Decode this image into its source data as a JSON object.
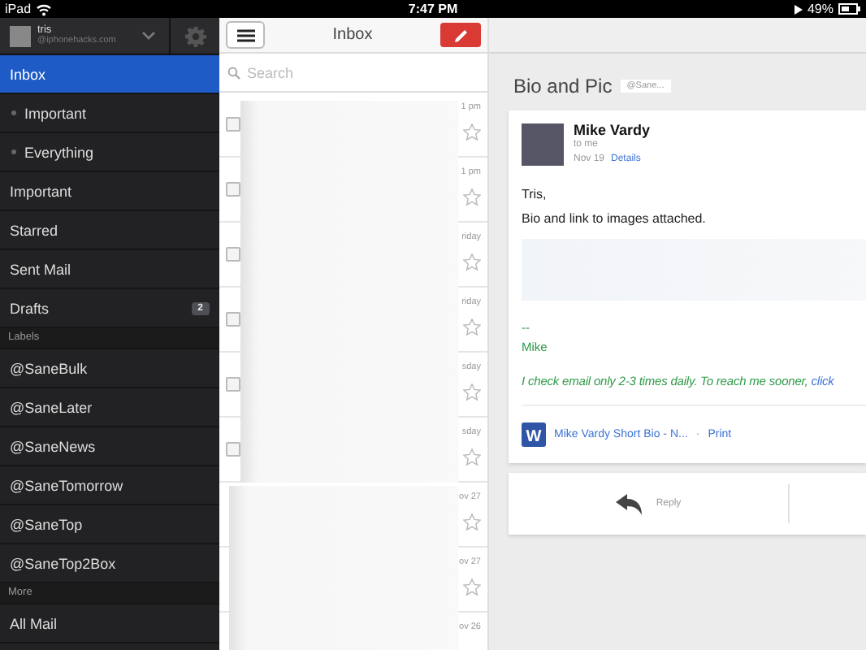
{
  "status_bar": {
    "device": "iPad",
    "time": "7:47 PM",
    "battery": "49%"
  },
  "account": {
    "name": "tris",
    "email": "@iphonehacks.com"
  },
  "sidebar": {
    "items": [
      {
        "kind": "item",
        "label": "Inbox",
        "selected": true
      },
      {
        "kind": "sub",
        "label": "Important",
        "selected": false
      },
      {
        "kind": "sub",
        "label": "Everything",
        "selected": false
      },
      {
        "kind": "item",
        "label": "Important",
        "selected": false
      },
      {
        "kind": "item",
        "label": "Starred",
        "selected": false
      },
      {
        "kind": "item",
        "label": "Sent Mail",
        "selected": false
      },
      {
        "kind": "item",
        "label": "Drafts",
        "selected": false,
        "count": "2"
      },
      {
        "kind": "header",
        "label": "Labels"
      },
      {
        "kind": "item",
        "label": "@SaneBulk",
        "selected": false
      },
      {
        "kind": "item",
        "label": "@SaneLater",
        "selected": false
      },
      {
        "kind": "item",
        "label": "@SaneNews",
        "selected": false
      },
      {
        "kind": "item",
        "label": "@SaneTomorrow",
        "selected": false
      },
      {
        "kind": "item",
        "label": "@SaneTop",
        "selected": false
      },
      {
        "kind": "item",
        "label": "@SaneTop2Box",
        "selected": false
      },
      {
        "kind": "header",
        "label": "More"
      },
      {
        "kind": "item",
        "label": "All Mail",
        "selected": false
      }
    ]
  },
  "inbox": {
    "title": "Inbox",
    "search": {
      "placeholder": "Search"
    },
    "rows": [
      {
        "kind": "checkbox",
        "time": "1 pm",
        "checked": false,
        "starred": false
      },
      {
        "kind": "checkbox",
        "time": "1 pm",
        "checked": false,
        "starred": false
      },
      {
        "kind": "checkbox",
        "time": "riday",
        "checked": false,
        "starred": false
      },
      {
        "kind": "checkbox",
        "time": "riday",
        "checked": false,
        "starred": false
      },
      {
        "kind": "checkbox",
        "time": "sday",
        "checked": false,
        "starred": false
      },
      {
        "kind": "checkbox",
        "time": "sday",
        "checked": false,
        "starred": false
      },
      {
        "kind": "plain",
        "time": "ov 27",
        "starred": false
      },
      {
        "kind": "plain",
        "time": "ov 27",
        "starred": false
      },
      {
        "kind": "plain",
        "time": "ov 26"
      }
    ]
  },
  "message": {
    "subject": "Bio and Pic",
    "label": "@Sane...",
    "sender": "Mike Vardy",
    "to": "to me",
    "date": "Nov 19",
    "details_link": "Details",
    "body": [
      "Tris,",
      "Bio and link to images attached."
    ],
    "signature_rule": "--",
    "signature_name": "Mike",
    "signature_note": "I check email only 2-3 times daily. To reach me sooner, ",
    "signature_link": "click",
    "attachment": {
      "icon_letter": "W",
      "name": "Mike Vardy Short Bio - N...",
      "separator": "·",
      "action": "Print"
    },
    "reply": "Reply"
  }
}
